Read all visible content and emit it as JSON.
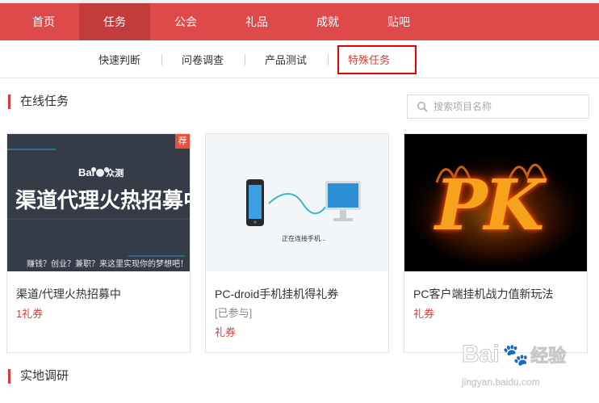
{
  "top_nav": {
    "items": [
      {
        "label": "首页"
      },
      {
        "label": "任务"
      },
      {
        "label": "公会"
      },
      {
        "label": "礼品"
      },
      {
        "label": "成就"
      },
      {
        "label": "贴吧"
      }
    ],
    "active_index": 1
  },
  "sub_nav": {
    "items": [
      {
        "label": "快速判断"
      },
      {
        "label": "问卷调查"
      },
      {
        "label": "产品测试"
      },
      {
        "label": "特殊任务"
      }
    ],
    "highlighted_index": 3
  },
  "sections": {
    "online_tasks": "在线任务",
    "field_research": "实地调研"
  },
  "search": {
    "placeholder": "搜索项目名称"
  },
  "cards": [
    {
      "title": "渠道/代理火热招募中",
      "reward": "1礼券",
      "badge": "荐",
      "image": {
        "brand": "Bai",
        "brand_suffix": "众测",
        "headline": "渠道代理火热招募中",
        "slogan": "赚钱？创业？兼职？来这里实现你的梦想吧！"
      }
    },
    {
      "title": "PC-droid手机挂机得礼券",
      "status": "[已参与]",
      "reward": "礼券",
      "image": {
        "caption": "正在连接手机..."
      }
    },
    {
      "title": "PC客户端挂机战力值新玩法",
      "reward": "礼券",
      "image": {
        "text": "PK"
      }
    }
  ],
  "watermark": {
    "brand": "Bai",
    "brand_cn": "经验",
    "url": "jingyan.baidu.com"
  },
  "colors": {
    "nav_red": "#de4a4a",
    "nav_active": "#c23c3c",
    "accent_red": "#d93a3a",
    "highlight_border": "#e60000"
  }
}
